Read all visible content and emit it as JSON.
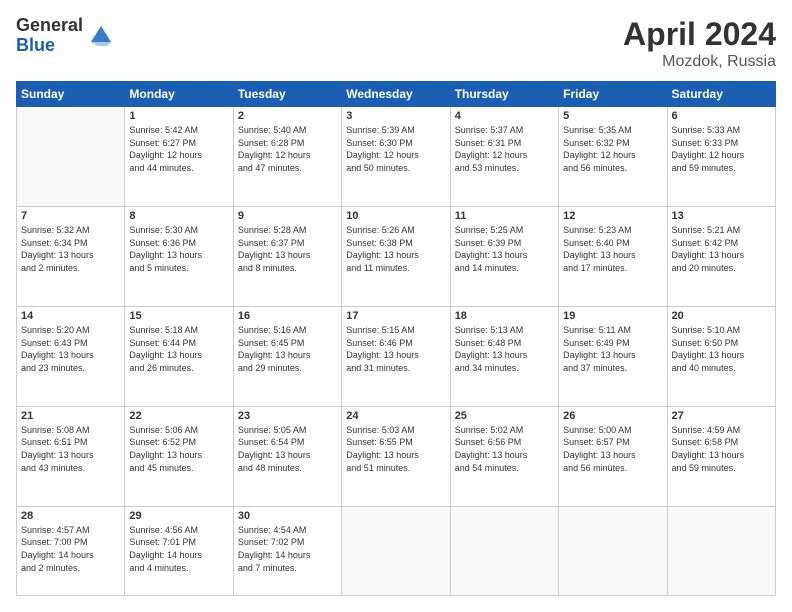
{
  "header": {
    "logo_general": "General",
    "logo_blue": "Blue",
    "title": "April 2024",
    "location": "Mozdok, Russia"
  },
  "weekdays": [
    "Sunday",
    "Monday",
    "Tuesday",
    "Wednesday",
    "Thursday",
    "Friday",
    "Saturday"
  ],
  "weeks": [
    [
      {
        "day": "",
        "info": ""
      },
      {
        "day": "1",
        "info": "Sunrise: 5:42 AM\nSunset: 6:27 PM\nDaylight: 12 hours\nand 44 minutes."
      },
      {
        "day": "2",
        "info": "Sunrise: 5:40 AM\nSunset: 6:28 PM\nDaylight: 12 hours\nand 47 minutes."
      },
      {
        "day": "3",
        "info": "Sunrise: 5:39 AM\nSunset: 6:30 PM\nDaylight: 12 hours\nand 50 minutes."
      },
      {
        "day": "4",
        "info": "Sunrise: 5:37 AM\nSunset: 6:31 PM\nDaylight: 12 hours\nand 53 minutes."
      },
      {
        "day": "5",
        "info": "Sunrise: 5:35 AM\nSunset: 6:32 PM\nDaylight: 12 hours\nand 56 minutes."
      },
      {
        "day": "6",
        "info": "Sunrise: 5:33 AM\nSunset: 6:33 PM\nDaylight: 12 hours\nand 59 minutes."
      }
    ],
    [
      {
        "day": "7",
        "info": "Sunrise: 5:32 AM\nSunset: 6:34 PM\nDaylight: 13 hours\nand 2 minutes."
      },
      {
        "day": "8",
        "info": "Sunrise: 5:30 AM\nSunset: 6:36 PM\nDaylight: 13 hours\nand 5 minutes."
      },
      {
        "day": "9",
        "info": "Sunrise: 5:28 AM\nSunset: 6:37 PM\nDaylight: 13 hours\nand 8 minutes."
      },
      {
        "day": "10",
        "info": "Sunrise: 5:26 AM\nSunset: 6:38 PM\nDaylight: 13 hours\nand 11 minutes."
      },
      {
        "day": "11",
        "info": "Sunrise: 5:25 AM\nSunset: 6:39 PM\nDaylight: 13 hours\nand 14 minutes."
      },
      {
        "day": "12",
        "info": "Sunrise: 5:23 AM\nSunset: 6:40 PM\nDaylight: 13 hours\nand 17 minutes."
      },
      {
        "day": "13",
        "info": "Sunrise: 5:21 AM\nSunset: 6:42 PM\nDaylight: 13 hours\nand 20 minutes."
      }
    ],
    [
      {
        "day": "14",
        "info": "Sunrise: 5:20 AM\nSunset: 6:43 PM\nDaylight: 13 hours\nand 23 minutes."
      },
      {
        "day": "15",
        "info": "Sunrise: 5:18 AM\nSunset: 6:44 PM\nDaylight: 13 hours\nand 26 minutes."
      },
      {
        "day": "16",
        "info": "Sunrise: 5:16 AM\nSunset: 6:45 PM\nDaylight: 13 hours\nand 29 minutes."
      },
      {
        "day": "17",
        "info": "Sunrise: 5:15 AM\nSunset: 6:46 PM\nDaylight: 13 hours\nand 31 minutes."
      },
      {
        "day": "18",
        "info": "Sunrise: 5:13 AM\nSunset: 6:48 PM\nDaylight: 13 hours\nand 34 minutes."
      },
      {
        "day": "19",
        "info": "Sunrise: 5:11 AM\nSunset: 6:49 PM\nDaylight: 13 hours\nand 37 minutes."
      },
      {
        "day": "20",
        "info": "Sunrise: 5:10 AM\nSunset: 6:50 PM\nDaylight: 13 hours\nand 40 minutes."
      }
    ],
    [
      {
        "day": "21",
        "info": "Sunrise: 5:08 AM\nSunset: 6:51 PM\nDaylight: 13 hours\nand 43 minutes."
      },
      {
        "day": "22",
        "info": "Sunrise: 5:06 AM\nSunset: 6:52 PM\nDaylight: 13 hours\nand 45 minutes."
      },
      {
        "day": "23",
        "info": "Sunrise: 5:05 AM\nSunset: 6:54 PM\nDaylight: 13 hours\nand 48 minutes."
      },
      {
        "day": "24",
        "info": "Sunrise: 5:03 AM\nSunset: 6:55 PM\nDaylight: 13 hours\nand 51 minutes."
      },
      {
        "day": "25",
        "info": "Sunrise: 5:02 AM\nSunset: 6:56 PM\nDaylight: 13 hours\nand 54 minutes."
      },
      {
        "day": "26",
        "info": "Sunrise: 5:00 AM\nSunset: 6:57 PM\nDaylight: 13 hours\nand 56 minutes."
      },
      {
        "day": "27",
        "info": "Sunrise: 4:59 AM\nSunset: 6:58 PM\nDaylight: 13 hours\nand 59 minutes."
      }
    ],
    [
      {
        "day": "28",
        "info": "Sunrise: 4:57 AM\nSunset: 7:00 PM\nDaylight: 14 hours\nand 2 minutes."
      },
      {
        "day": "29",
        "info": "Sunrise: 4:56 AM\nSunset: 7:01 PM\nDaylight: 14 hours\nand 4 minutes."
      },
      {
        "day": "30",
        "info": "Sunrise: 4:54 AM\nSunset: 7:02 PM\nDaylight: 14 hours\nand 7 minutes."
      },
      {
        "day": "",
        "info": ""
      },
      {
        "day": "",
        "info": ""
      },
      {
        "day": "",
        "info": ""
      },
      {
        "day": "",
        "info": ""
      }
    ]
  ]
}
